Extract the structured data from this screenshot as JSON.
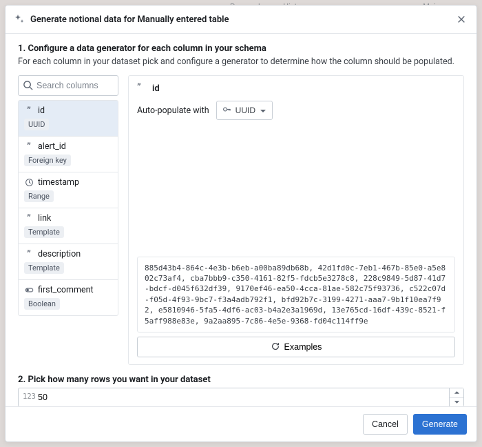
{
  "background_tabs": [
    "Proposals",
    "History",
    "Main"
  ],
  "modal": {
    "title": "Generate notional data for Manually entered table",
    "step1": {
      "heading": "1. Configure a data generator for each column in your schema",
      "sub": "For each column in your dataset pick and configure a generator to determine how the column should be populated."
    },
    "search": {
      "placeholder": "Search columns"
    },
    "columns": [
      {
        "name": "id",
        "type": "string",
        "badge": "UUID",
        "selected": true
      },
      {
        "name": "alert_id",
        "type": "string",
        "badge": "Foreign key",
        "selected": false
      },
      {
        "name": "timestamp",
        "type": "clock",
        "badge": "Range",
        "selected": false
      },
      {
        "name": "link",
        "type": "string",
        "badge": "Template",
        "selected": false
      },
      {
        "name": "description",
        "type": "string",
        "badge": "Template",
        "selected": false
      },
      {
        "name": "first_comment",
        "type": "toggle",
        "badge": "Boolean",
        "selected": false
      }
    ],
    "detail": {
      "column_name": "id",
      "auto_label": "Auto-populate with",
      "generator_label": "UUID",
      "sample": "885d43b4-864c-4e3b-b6eb-a00ba89db68b, 42d1fd0c-7eb1-467b-85e0-a5e802c73af4, cba7bbb9-c350-4161-82f5-fdcb5e3278c8, 228c9849-5d87-41d7-bdcf-d045f632df39, 9170ef46-ea50-4cca-81ae-582c75f93736, c522c07d-f05d-4f93-9bc7-f3a4adb792f1, bfd92b7c-3199-4271-aaa7-9b1f10ea7f92, e5810946-5fa5-4df6-ac03-b4a2e3a1969d, 13e765cd-16df-439c-8521-f5aff988e83e, 9a2aa895-7c86-4e5e-9368-fd04c114ff9e",
      "examples_label": "Examples"
    },
    "step2": {
      "heading": "2. Pick how many rows you want in your dataset",
      "value": "50",
      "prefix": "123"
    },
    "footer": {
      "cancel": "Cancel",
      "generate": "Generate"
    }
  }
}
